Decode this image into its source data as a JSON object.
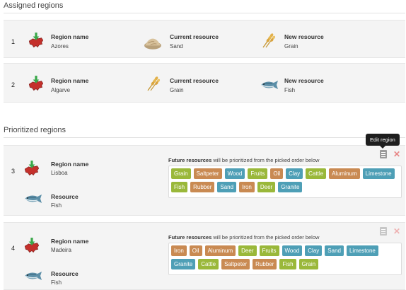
{
  "assigned": {
    "title": "Assigned regions",
    "rows": [
      {
        "number": "1",
        "region_label": "Region name",
        "region": "Azores",
        "current_label": "Current resource",
        "current": "Sand",
        "new_label": "New resource",
        "new": "Grain",
        "current_icon": "sand-pile-icon",
        "new_icon": "wheat-icon"
      },
      {
        "number": "2",
        "region_label": "Region name",
        "region": "Algarve",
        "current_label": "Current resource",
        "current": "Grain",
        "new_label": "New resource",
        "new": "Fish",
        "current_icon": "wheat-icon",
        "new_icon": "fish-icon"
      }
    ]
  },
  "prioritized": {
    "title": "Prioritized regions",
    "future_bold": "Future resources",
    "future_rest": " will be prioritized from the picked order below",
    "tooltip": "Edit region",
    "rows": [
      {
        "number": "3",
        "region_label": "Region name",
        "region": "Lisboa",
        "resource_label": "Resource",
        "resource": "Fish",
        "tags": [
          {
            "text": "Grain",
            "color": "green"
          },
          {
            "text": "Saltpeter",
            "color": "brown"
          },
          {
            "text": "Wood",
            "color": "blue"
          },
          {
            "text": "Fruits",
            "color": "green"
          },
          {
            "text": "Oil",
            "color": "brown"
          },
          {
            "text": "Clay",
            "color": "blue"
          },
          {
            "text": "Cattle",
            "color": "green"
          },
          {
            "text": "Aluminum",
            "color": "brown"
          },
          {
            "text": "Limestone",
            "color": "blue"
          },
          {
            "text": "Fish",
            "color": "green"
          },
          {
            "text": "Rubber",
            "color": "brown"
          },
          {
            "text": "Sand",
            "color": "blue"
          },
          {
            "text": "Iron",
            "color": "brown"
          },
          {
            "text": "Deer",
            "color": "green"
          },
          {
            "text": "Granite",
            "color": "blue"
          }
        ]
      },
      {
        "number": "4",
        "region_label": "Region name",
        "region": "Madeira",
        "resource_label": "Resource",
        "resource": "Fish",
        "tags": [
          {
            "text": "Iron",
            "color": "brown"
          },
          {
            "text": "Oil",
            "color": "brown"
          },
          {
            "text": "Aluminum",
            "color": "brown"
          },
          {
            "text": "Deer",
            "color": "green"
          },
          {
            "text": "Fruits",
            "color": "green"
          },
          {
            "text": "Wood",
            "color": "blue"
          },
          {
            "text": "Clay",
            "color": "blue"
          },
          {
            "text": "Sand",
            "color": "blue"
          },
          {
            "text": "Limestone",
            "color": "blue"
          },
          {
            "text": "Granite",
            "color": "blue"
          },
          {
            "text": "Cattle",
            "color": "green"
          },
          {
            "text": "Saltpeter",
            "color": "brown"
          },
          {
            "text": "Rubber",
            "color": "brown"
          },
          {
            "text": "Fish",
            "color": "green"
          },
          {
            "text": "Grain",
            "color": "green"
          }
        ]
      }
    ]
  },
  "colors": {
    "green": "#9ab83a",
    "brown": "#c98a52",
    "blue": "#4e9fb6"
  }
}
